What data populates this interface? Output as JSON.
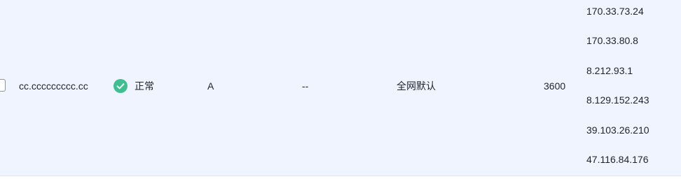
{
  "record": {
    "host": "cc.ccccccccc.cc",
    "status": "正常",
    "type": "A",
    "mx": "--",
    "line": "全网默认",
    "ttl": "3600",
    "values": [
      "170.33.73.24",
      "170.33.80.8",
      "8.212.93.1",
      "8.129.152.243",
      "39.103.26.210",
      "47.116.84.176"
    ]
  },
  "icons": {
    "status_icon": "check-circle-icon",
    "status_color": "#3fbf8f"
  }
}
